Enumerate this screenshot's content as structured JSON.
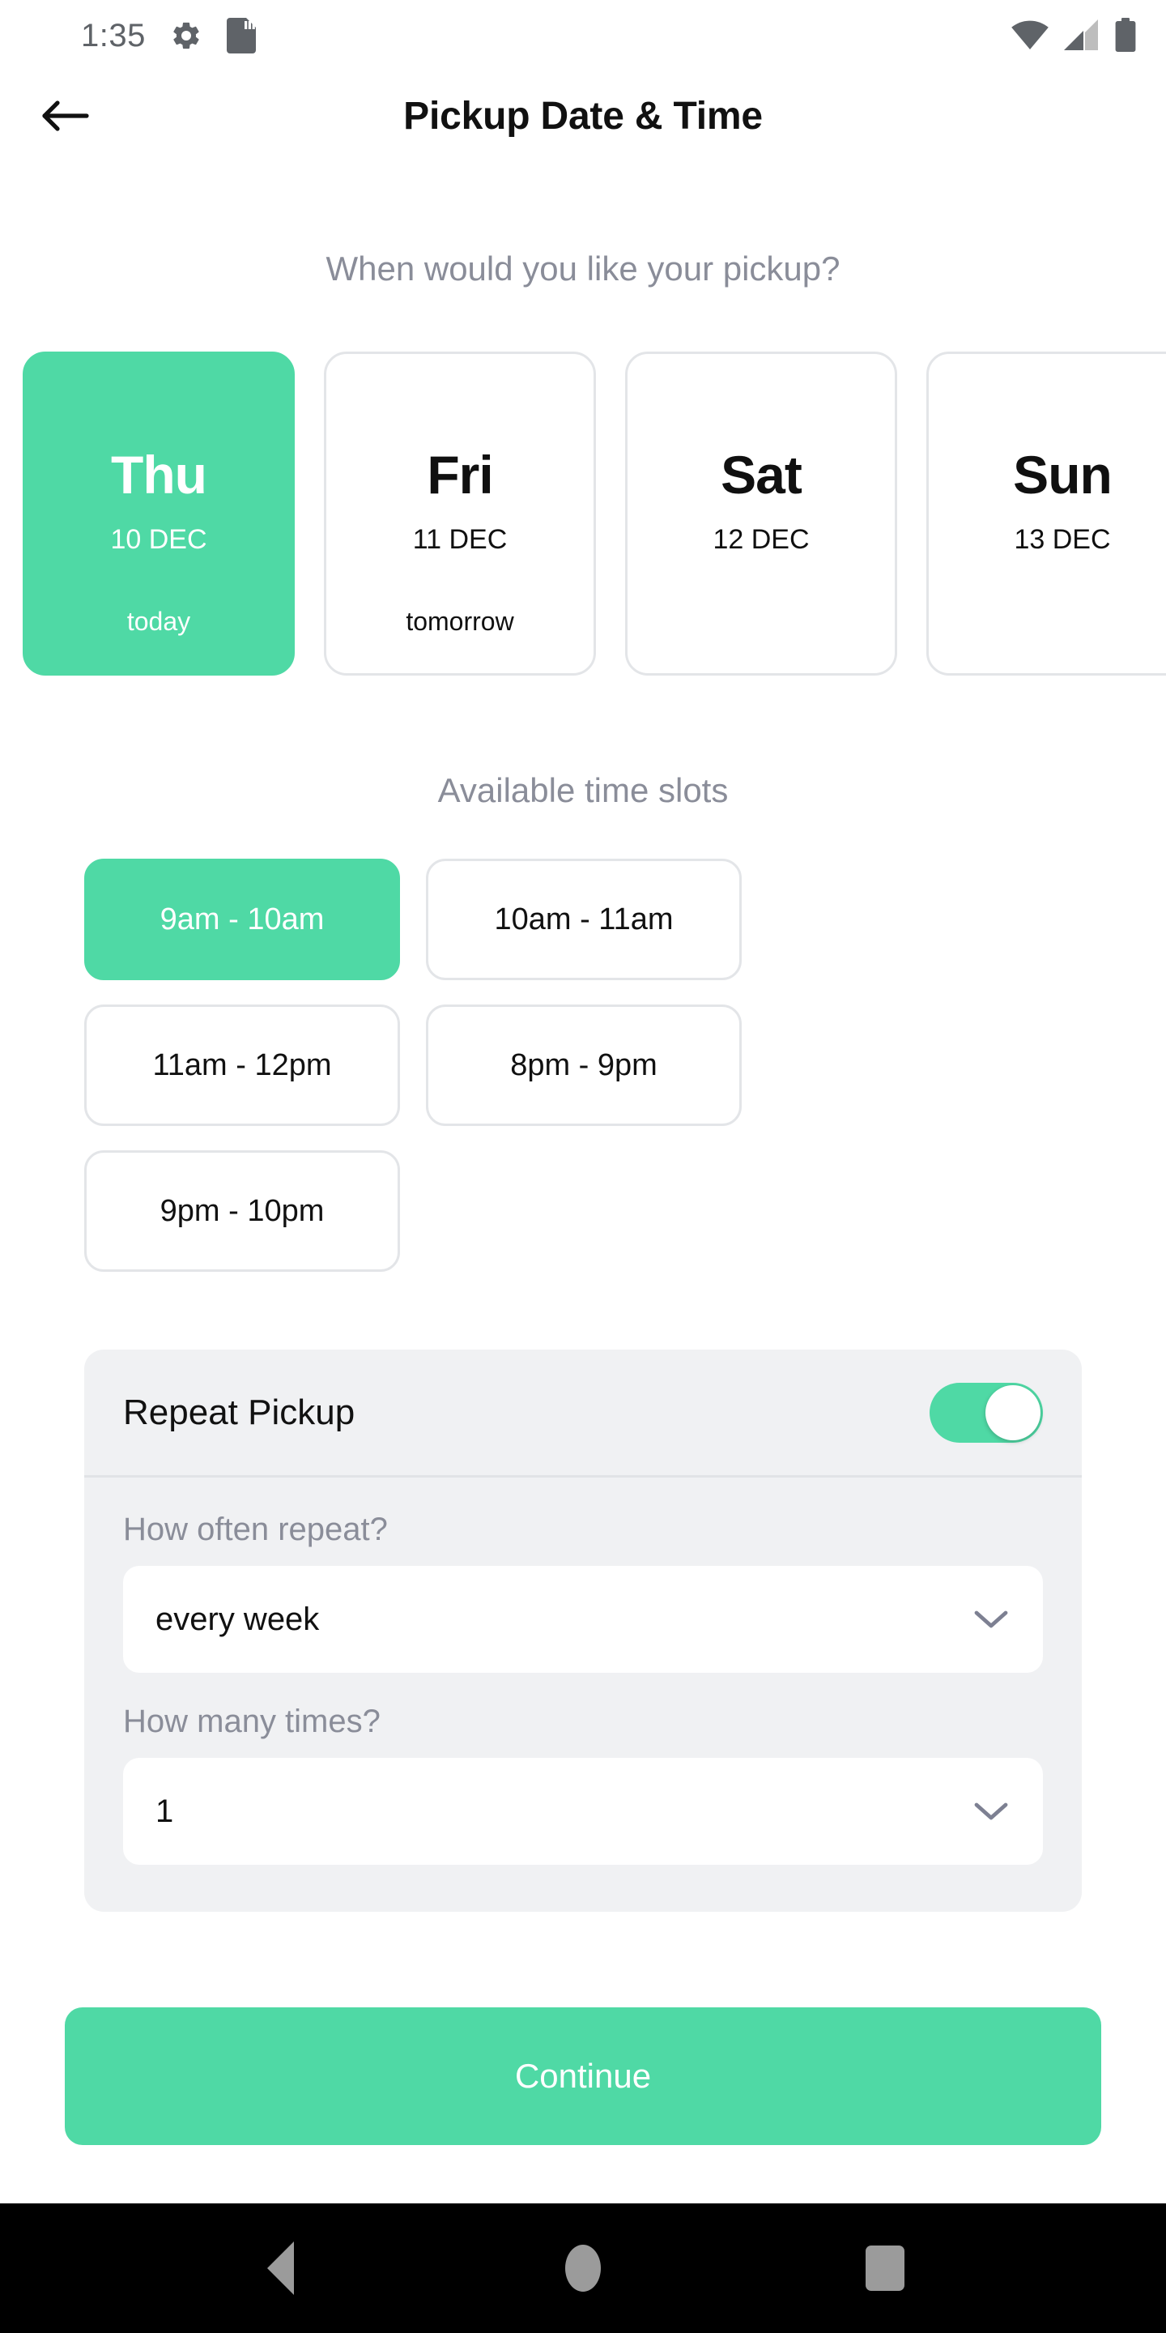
{
  "status_bar": {
    "clock": "1:35",
    "icons_left": [
      "settings-gear-icon",
      "sd-card-icon"
    ],
    "icons_right": [
      "wifi-icon",
      "cellular-signal-icon",
      "battery-icon"
    ]
  },
  "app_bar": {
    "back_icon": "back-arrow-icon",
    "title": "Pickup Date & Time"
  },
  "main": {
    "question": "When would you like your pickup?",
    "dates": [
      {
        "dow": "Thu",
        "date": "10 DEC",
        "relative": "today",
        "selected": true
      },
      {
        "dow": "Fri",
        "date": "11 DEC",
        "relative": "tomorrow",
        "selected": false
      },
      {
        "dow": "Sat",
        "date": "12 DEC",
        "relative": "",
        "selected": false
      },
      {
        "dow": "Sun",
        "date": "13 DEC",
        "relative": "",
        "selected": false
      }
    ],
    "slots_title": "Available time slots",
    "slots": [
      {
        "label": "9am - 10am",
        "selected": true
      },
      {
        "label": "10am - 11am",
        "selected": false
      },
      {
        "label": "11am - 12pm",
        "selected": false
      },
      {
        "label": "8pm - 9pm",
        "selected": false
      },
      {
        "label": "9pm - 10pm",
        "selected": false
      }
    ],
    "repeat": {
      "title": "Repeat Pickup",
      "toggle_on": true,
      "frequency_label": "How often repeat?",
      "frequency_value": "every week",
      "count_label": "How many times?",
      "count_value": "1",
      "chevron_icon": "chevron-down-icon"
    },
    "continue_label": "Continue"
  },
  "nav_bar": {
    "back": "nav-back-icon",
    "home": "nav-home-icon",
    "recents": "nav-recents-icon"
  },
  "colors": {
    "accent": "#4FD9A5",
    "panel": "#F0F1F3",
    "muted_text": "#8a8d99",
    "border": "#e3e5e8"
  }
}
